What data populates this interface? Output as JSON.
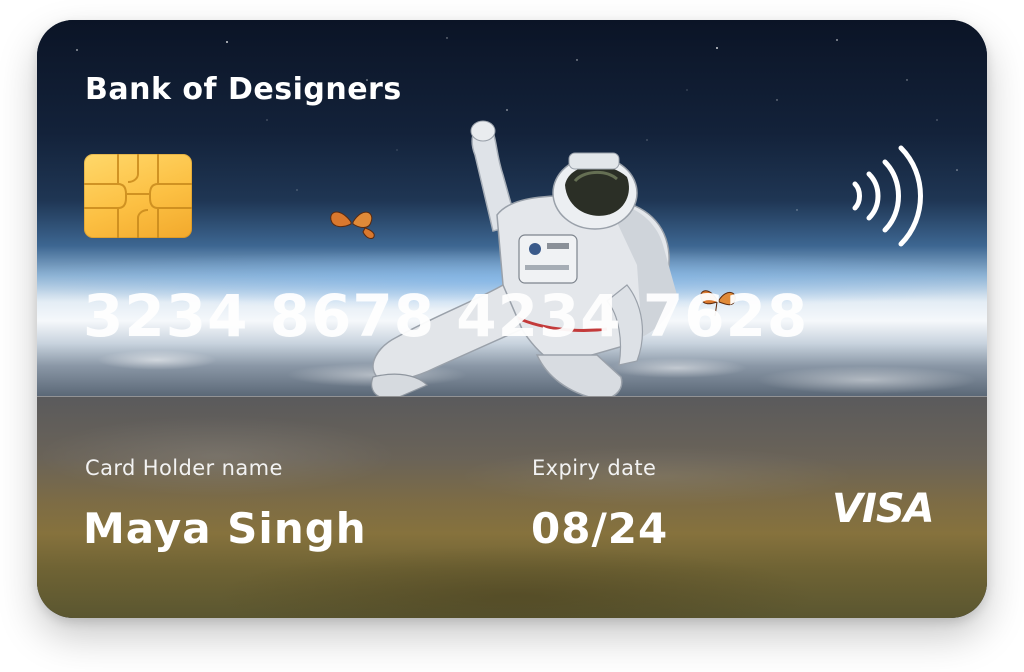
{
  "card": {
    "bank_name": "Bank of Designers",
    "number": "3234 8678 4234 7628",
    "holder_label": "Card Holder name",
    "holder_name": "Maya Singh",
    "expiry_label": "Expiry date",
    "expiry_date": "08/24",
    "network": "VISA"
  },
  "icons": {
    "chip": "emv-chip-icon",
    "contactless": "contactless-icon",
    "network_logo": "visa-logo"
  },
  "colors": {
    "chip_gold": "#fcc043",
    "text": "#ffffff",
    "space_dark": "#0b1426"
  }
}
